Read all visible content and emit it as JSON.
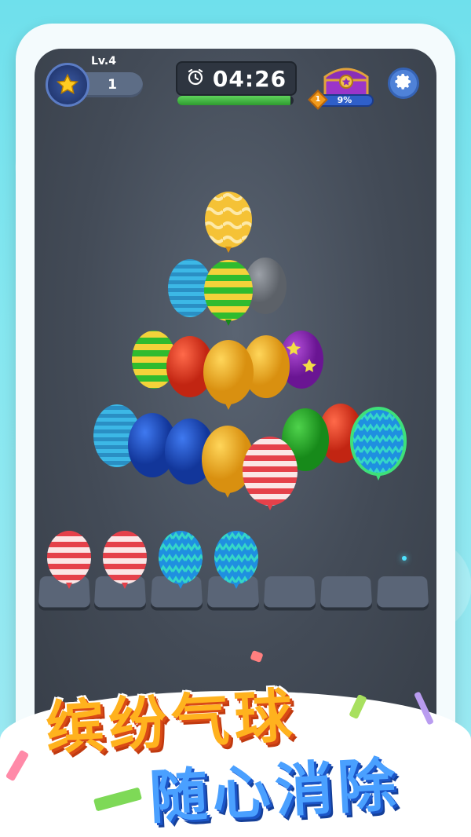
{
  "hud": {
    "level_label": "Lv.4",
    "stars": "1",
    "timer": "04:26",
    "timer_progress": 0.97,
    "chest_level": "1",
    "chest_progress": "9%"
  },
  "icons": {
    "star": "star-icon",
    "alarm": "alarm-clock-icon",
    "chest": "treasure-chest-icon",
    "settings": "gear-icon"
  },
  "slots": {
    "count": 7,
    "filled": [
      "red-stripe",
      "red-stripe",
      "blue-zigzag",
      "blue-zigzag"
    ]
  },
  "banner": {
    "line1": "缤纷气球",
    "line2": "随心消除"
  },
  "colors": {
    "accent_orange": "#ffb21e",
    "accent_blue": "#4aa0ff",
    "timer_green": "#3fba3c",
    "background": "#7ee5ee"
  }
}
